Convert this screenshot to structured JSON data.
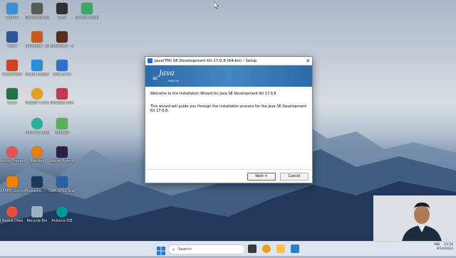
{
  "desktop": {
    "icons": [
      {
        "label": "This PC",
        "color": "#3b8fd6"
      },
      {
        "label": "GeoGebra 2023 Edition",
        "color": "#5a5a5a"
      },
      {
        "label": "OBS",
        "color": "#303030"
      },
      {
        "label": "Filmora Studio",
        "color": "#3aa86b"
      },
      {
        "label": "Word",
        "color": "#2b579a"
      },
      {
        "label": "Mathtype - Shortcut",
        "color": "#c85a1e"
      },
      {
        "label": "Bandicam - Shortcut",
        "color": "#5a2e1f"
      },
      {
        "label": "PowerPoint",
        "color": "#d04423"
      },
      {
        "label": "Visual Studio Code",
        "color": "#2a8fd6"
      },
      {
        "label": "One Drive",
        "color": "#3070d0"
      },
      {
        "label": "Excel",
        "color": "#217346"
      },
      {
        "label": "Kodular Chrome",
        "color": "#e8a020"
      },
      {
        "label": "MetaBay Windows",
        "color": "#c5384b"
      },
      {
        "label": "Microsoft Edge",
        "color": "#2bb0a0"
      },
      {
        "label": "WinRAR",
        "color": "#5bb05b"
      },
      {
        "label": "Active Presenter",
        "color": "#e05656"
      },
      {
        "label": "Blender",
        "color": "#e87d0d"
      },
      {
        "label": "Adobe Animate",
        "color": "#2b1f4a"
      },
      {
        "label": "XAMPP Contr...",
        "color": "#f08000"
      },
      {
        "label": "Photosho... - Shortcut",
        "color": "#1b3a5c"
      },
      {
        "label": "IBM SPSS Statistics",
        "color": "#2a5fa8"
      },
      {
        "label": "I Kadek Diwa Anjayuyan...",
        "color": "#e84d3d"
      },
      {
        "label": "Recycle Bin",
        "color": "#9ab0c4"
      },
      {
        "label": "Arduino IDE",
        "color": "#00979c"
      }
    ]
  },
  "dialog": {
    "title": "Java(TM) SE Development Kit 17.0.8 (64-bit) - Setup",
    "close_glyph": "✕",
    "logo_text": "Java",
    "logo_sub": "ORACLE",
    "welcome": "Welcome to the Installation Wizard for Java SE Development Kit 17.0.8",
    "guide": "This wizard will guide you through the installation process for the Java SE Development Kit 17.0.8.",
    "next_label": "Next >",
    "cancel_label": "Cancel"
  },
  "taskbar": {
    "search_placeholder": "Search",
    "language": "IND",
    "time": "15:54",
    "date": "9/14/2023"
  }
}
